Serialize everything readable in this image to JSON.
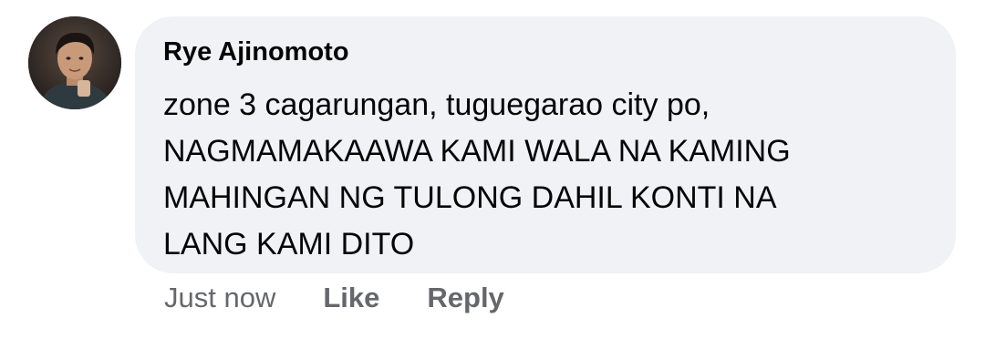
{
  "comment": {
    "author": "Rye Ajinomoto",
    "lines": [
      "zone 3 cagarungan, tuguegarao city po,",
      "NAGMAMAKAAWA KAMI WALA NA KAMING",
      "MAHINGAN NG TULONG DAHIL KONTI NA",
      "LANG KAMI DITO"
    ],
    "timestamp": "Just now",
    "like_label": "Like",
    "reply_label": "Reply",
    "bubble_color": "#f0f2f5",
    "meta_text_color": "#65676b"
  }
}
